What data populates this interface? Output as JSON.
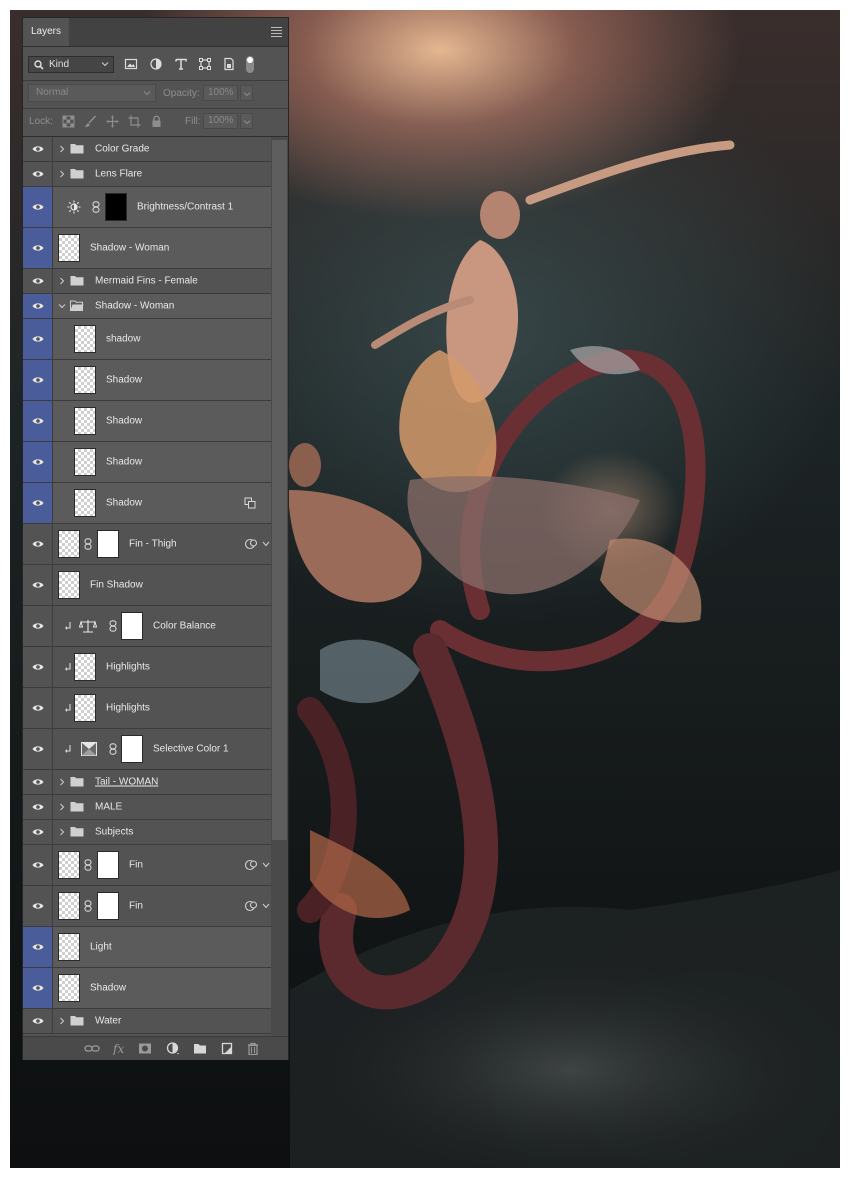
{
  "panel": {
    "tab_label": "Layers"
  },
  "filter": {
    "kind_label": "Kind"
  },
  "blend": {
    "mode": "Normal",
    "opacity_label": "Opacity:",
    "opacity_value": "100%"
  },
  "lock": {
    "label": "Lock:",
    "fill_label": "Fill:",
    "fill_value": "100%"
  },
  "layers": [
    {
      "name": "Color Grade",
      "kind": "group"
    },
    {
      "name": "Lens Flare",
      "kind": "group"
    },
    {
      "name": "Brightness/Contrast 1",
      "kind": "adjustment",
      "selected": true
    },
    {
      "name": "Shadow - Woman",
      "kind": "pixel",
      "selected": true
    },
    {
      "name": "Mermaid Fins - Female",
      "kind": "group"
    },
    {
      "name": "Shadow - Woman",
      "kind": "group-open",
      "selected": true
    },
    {
      "name": "shadow",
      "kind": "pixel",
      "selected": true
    },
    {
      "name": "Shadow",
      "kind": "pixel",
      "selected": true
    },
    {
      "name": "Shadow",
      "kind": "pixel",
      "selected": true
    },
    {
      "name": "Shadow",
      "kind": "pixel",
      "selected": true
    },
    {
      "name": "Shadow",
      "kind": "pixel",
      "selected": true
    },
    {
      "name": "Fin - Thigh",
      "kind": "smart-masked"
    },
    {
      "name": "Fin Shadow",
      "kind": "pixel"
    },
    {
      "name": "Color Balance",
      "kind": "adjustment-clipped"
    },
    {
      "name": "Highlights",
      "kind": "pixel-clipped"
    },
    {
      "name": "Highlights",
      "kind": "pixel-clipped"
    },
    {
      "name": "Selective Color 1",
      "kind": "adjustment-clipped"
    },
    {
      "name": "Tail - WOMAN",
      "kind": "group"
    },
    {
      "name": "MALE",
      "kind": "group"
    },
    {
      "name": "Subjects",
      "kind": "group"
    },
    {
      "name": "Fin",
      "kind": "smart-masked"
    },
    {
      "name": "Fin",
      "kind": "smart-masked"
    },
    {
      "name": "Light",
      "kind": "pixel",
      "selected": true
    },
    {
      "name": "Shadow",
      "kind": "pixel",
      "selected": true
    },
    {
      "name": "Water",
      "kind": "group"
    }
  ],
  "colors": {
    "panel_bg": "#535353",
    "selection_eye": "#4a5c9a",
    "tab_bar": "#424242"
  },
  "icons": [
    "search-icon",
    "image-filter-icon",
    "adjustment-filter-icon",
    "type-filter-icon",
    "shape-filter-icon",
    "smart-object-filter-icon",
    "lock-transparent-icon",
    "lock-paint-icon",
    "lock-move-icon",
    "lock-artboard-icon",
    "lock-all-icon",
    "eye-icon",
    "folder-icon",
    "link-icon",
    "fx-icon",
    "add-mask-icon",
    "new-fill-adjustment-icon",
    "new-group-icon",
    "new-layer-icon",
    "trash-icon"
  ]
}
